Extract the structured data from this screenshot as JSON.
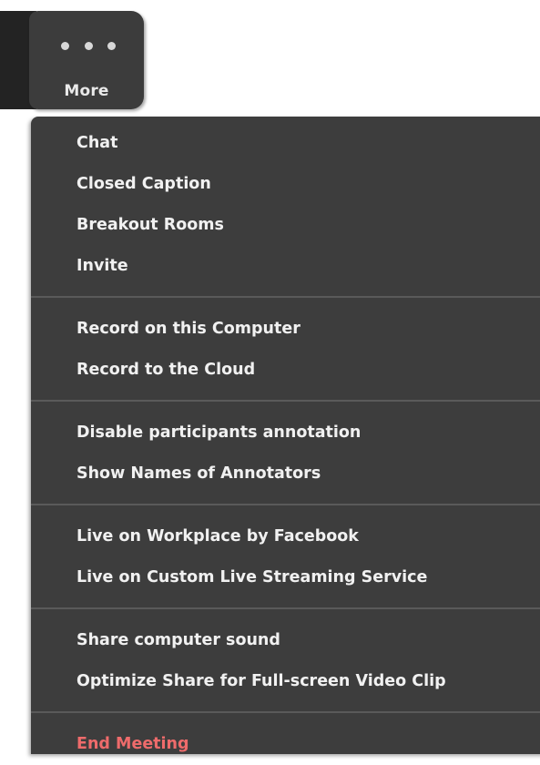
{
  "toolbar": {
    "more_button": {
      "icon": "ellipsis-icon",
      "label": "More"
    }
  },
  "menu": {
    "groups": [
      {
        "items": [
          {
            "label": "Chat"
          },
          {
            "label": "Closed Caption"
          },
          {
            "label": "Breakout Rooms"
          },
          {
            "label": "Invite"
          }
        ]
      },
      {
        "items": [
          {
            "label": "Record on this Computer"
          },
          {
            "label": "Record to the Cloud"
          }
        ]
      },
      {
        "items": [
          {
            "label": "Disable participants annotation"
          },
          {
            "label": "Show Names of Annotators"
          }
        ]
      },
      {
        "items": [
          {
            "label": "Live on Workplace by Facebook"
          },
          {
            "label": "Live on Custom Live Streaming Service"
          }
        ]
      },
      {
        "items": [
          {
            "label": "Share computer sound"
          },
          {
            "label": "Optimize Share for Full-screen Video Clip"
          }
        ]
      },
      {
        "items": [
          {
            "label": "End Meeting"
          }
        ]
      }
    ]
  },
  "colors": {
    "menu_background": "#3d3d3d",
    "menu_text": "#f1f1f1",
    "danger_text": "#ee6b6b",
    "divider": "#5a5a5a"
  }
}
